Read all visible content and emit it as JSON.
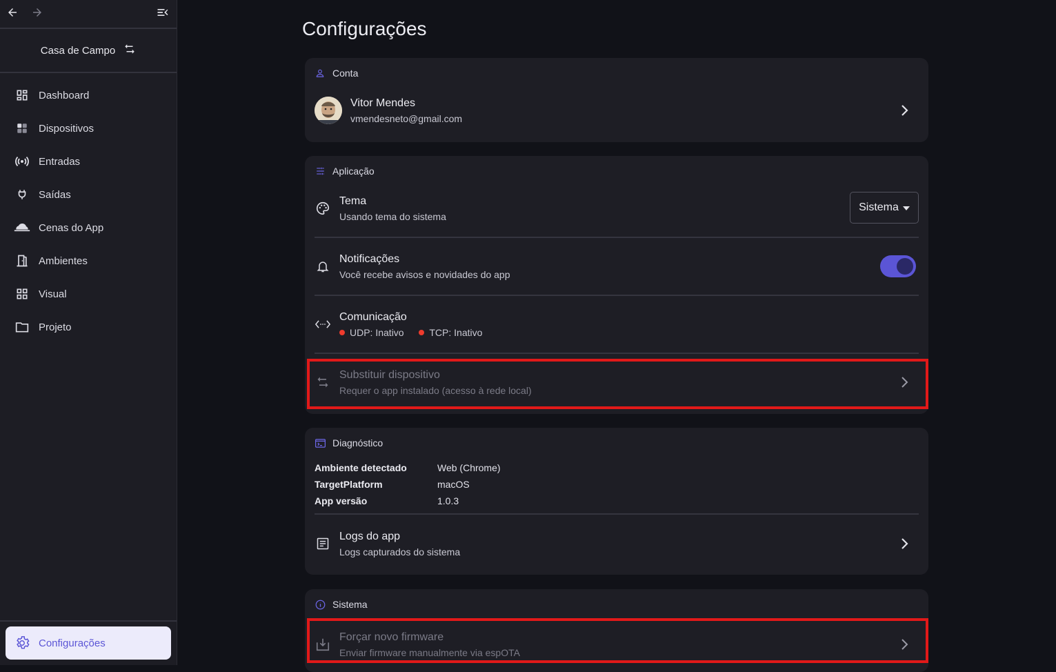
{
  "colors": {
    "accent": "#5b55d6",
    "highlight": "#e11919",
    "status_inactive": "#ef3b2d",
    "background": "#111218",
    "card": "#1e1e25"
  },
  "sidebar": {
    "home_name": "Casa de Campo",
    "items": [
      {
        "label": "Dashboard",
        "icon": "dashboard-icon"
      },
      {
        "label": "Dispositivos",
        "icon": "devices-icon"
      },
      {
        "label": "Entradas",
        "icon": "broadcast-icon"
      },
      {
        "label": "Saídas",
        "icon": "plug-icon"
      },
      {
        "label": "Cenas do App",
        "icon": "cloud-icon"
      },
      {
        "label": "Ambientes",
        "icon": "door-icon"
      },
      {
        "label": "Visual",
        "icon": "grid-icon"
      },
      {
        "label": "Projeto",
        "icon": "folder-icon"
      }
    ],
    "settings_label": "Configurações"
  },
  "page": {
    "title": "Configurações"
  },
  "account": {
    "header": "Conta",
    "name": "Vitor Mendes",
    "email": "vmendesneto@gmail.com"
  },
  "application": {
    "header": "Aplicação",
    "theme": {
      "title": "Tema",
      "subtitle": "Usando tema do sistema",
      "selected": "Sistema"
    },
    "notifications": {
      "title": "Notificações",
      "subtitle": "Você recebe avisos e novidades do app",
      "enabled": true
    },
    "communication": {
      "title": "Comunicação",
      "udp": "UDP: Inativo",
      "tcp": "TCP: Inativo"
    },
    "replace_device": {
      "title": "Substituir dispositivo",
      "subtitle": "Requer o app instalado (acesso à rede local)"
    }
  },
  "diagnostics": {
    "header": "Diagnóstico",
    "rows": [
      {
        "key": "Ambiente detectado",
        "value": "Web (Chrome)"
      },
      {
        "key": "TargetPlatform",
        "value": "macOS"
      },
      {
        "key": "App versão",
        "value": "1.0.3"
      }
    ],
    "logs": {
      "title": "Logs do app",
      "subtitle": "Logs capturados do sistema"
    }
  },
  "system": {
    "header": "Sistema",
    "firmware": {
      "title": "Forçar novo firmware",
      "subtitle": "Enviar firmware manualmente via espOTA"
    }
  }
}
